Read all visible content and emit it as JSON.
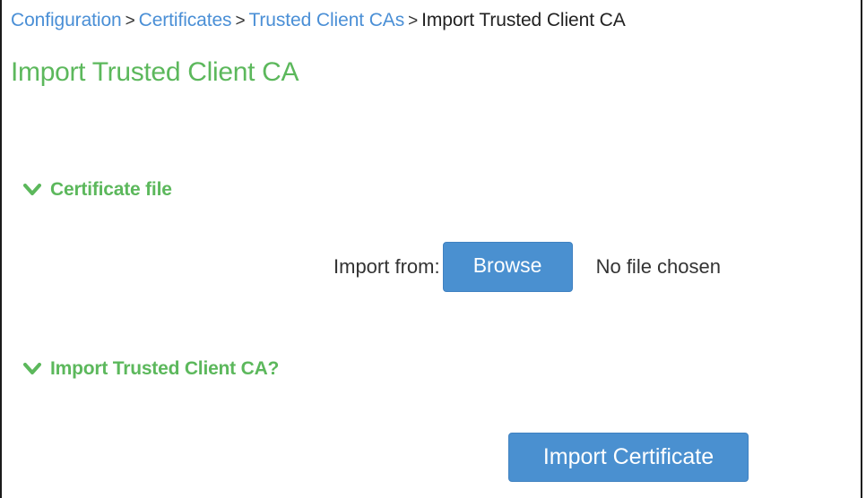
{
  "breadcrumb": {
    "items": [
      "Configuration",
      "Certificates",
      "Trusted Client CAs"
    ],
    "separator": ">",
    "current": "Import Trusted Client CA"
  },
  "page": {
    "title": "Import Trusted Client CA"
  },
  "sections": {
    "certificate_file": {
      "title": "Certificate file",
      "icon": "chevron-down-icon"
    },
    "import_confirm": {
      "title": "Import Trusted Client CA?",
      "icon": "chevron-down-icon"
    }
  },
  "file_input": {
    "label": "Import from:",
    "button_label": "Browse",
    "status": "No file chosen"
  },
  "actions": {
    "import_label": "Import Certificate"
  },
  "colors": {
    "link": "#4a8fd6",
    "accent_green": "#5cb85c",
    "button_blue": "#4a90d0"
  }
}
